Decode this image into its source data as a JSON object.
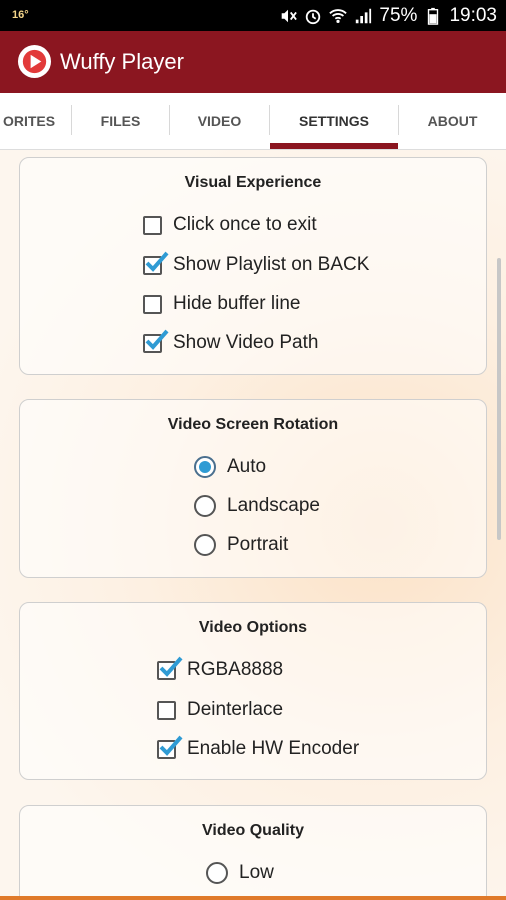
{
  "status_bar": {
    "notification_temp": "16°",
    "battery": "75%",
    "time": "19:03",
    "icons": [
      "mute-icon",
      "alarm-icon",
      "wifi-icon",
      "signal-icon",
      "battery-icon"
    ]
  },
  "app": {
    "title": "Wuffy Player",
    "brand_color": "#8b1620",
    "accent_color": "#2f9bd4"
  },
  "tabs": [
    {
      "label": "ORITES",
      "active": false
    },
    {
      "label": "FILES",
      "active": false
    },
    {
      "label": "VIDEO",
      "active": false
    },
    {
      "label": "SETTINGS",
      "active": true
    },
    {
      "label": "ABOUT",
      "active": false
    }
  ],
  "sections": {
    "visual": {
      "title": "Visual Experience",
      "options": [
        {
          "label": "Click once to exit",
          "checked": false
        },
        {
          "label": "Show Playlist on BACK",
          "checked": true
        },
        {
          "label": "Hide buffer line",
          "checked": false
        },
        {
          "label": "Show Video Path",
          "checked": true
        }
      ]
    },
    "rotation": {
      "title": "Video Screen Rotation",
      "options": [
        {
          "label": "Auto",
          "selected": true
        },
        {
          "label": "Landscape",
          "selected": false
        },
        {
          "label": "Portrait",
          "selected": false
        }
      ]
    },
    "video_options": {
      "title": "Video Options",
      "options": [
        {
          "label": "RGBA8888",
          "checked": true
        },
        {
          "label": "Deinterlace",
          "checked": false
        },
        {
          "label": "Enable HW Encoder",
          "checked": true
        }
      ]
    },
    "quality": {
      "title": "Video Quality",
      "options": [
        {
          "label": "Low",
          "selected": false
        }
      ]
    }
  }
}
